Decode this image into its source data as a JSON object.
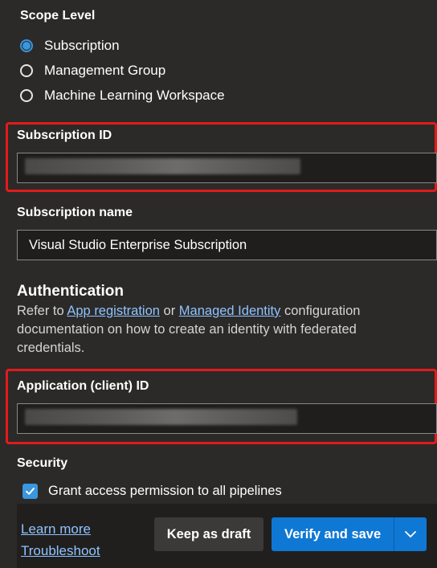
{
  "scope": {
    "heading": "Scope Level",
    "options": [
      {
        "label": "Subscription",
        "selected": true
      },
      {
        "label": "Management Group",
        "selected": false
      },
      {
        "label": "Machine Learning Workspace",
        "selected": false
      }
    ]
  },
  "subscription_id": {
    "label": "Subscription ID"
  },
  "subscription_name": {
    "label": "Subscription name",
    "value": "Visual Studio Enterprise Subscription"
  },
  "authentication": {
    "heading": "Authentication",
    "text_1": "Refer to ",
    "link_app_registration": "App registration",
    "text_2": " or ",
    "link_managed_identity": "Managed Identity",
    "text_3": " configuration documentation on how to create an identity with federated credentials."
  },
  "application_id": {
    "label": "Application (client) ID"
  },
  "security": {
    "heading": "Security",
    "grant_access_label": "Grant access permission to all pipelines",
    "grant_access_checked": true
  },
  "footer": {
    "learn_more": "Learn more",
    "troubleshoot": "Troubleshoot",
    "keep_draft": "Keep as draft",
    "verify_save": "Verify and save"
  },
  "colors": {
    "highlight": "#e21b1b",
    "accent": "#0f78d4",
    "link": "#8fc3ff"
  }
}
